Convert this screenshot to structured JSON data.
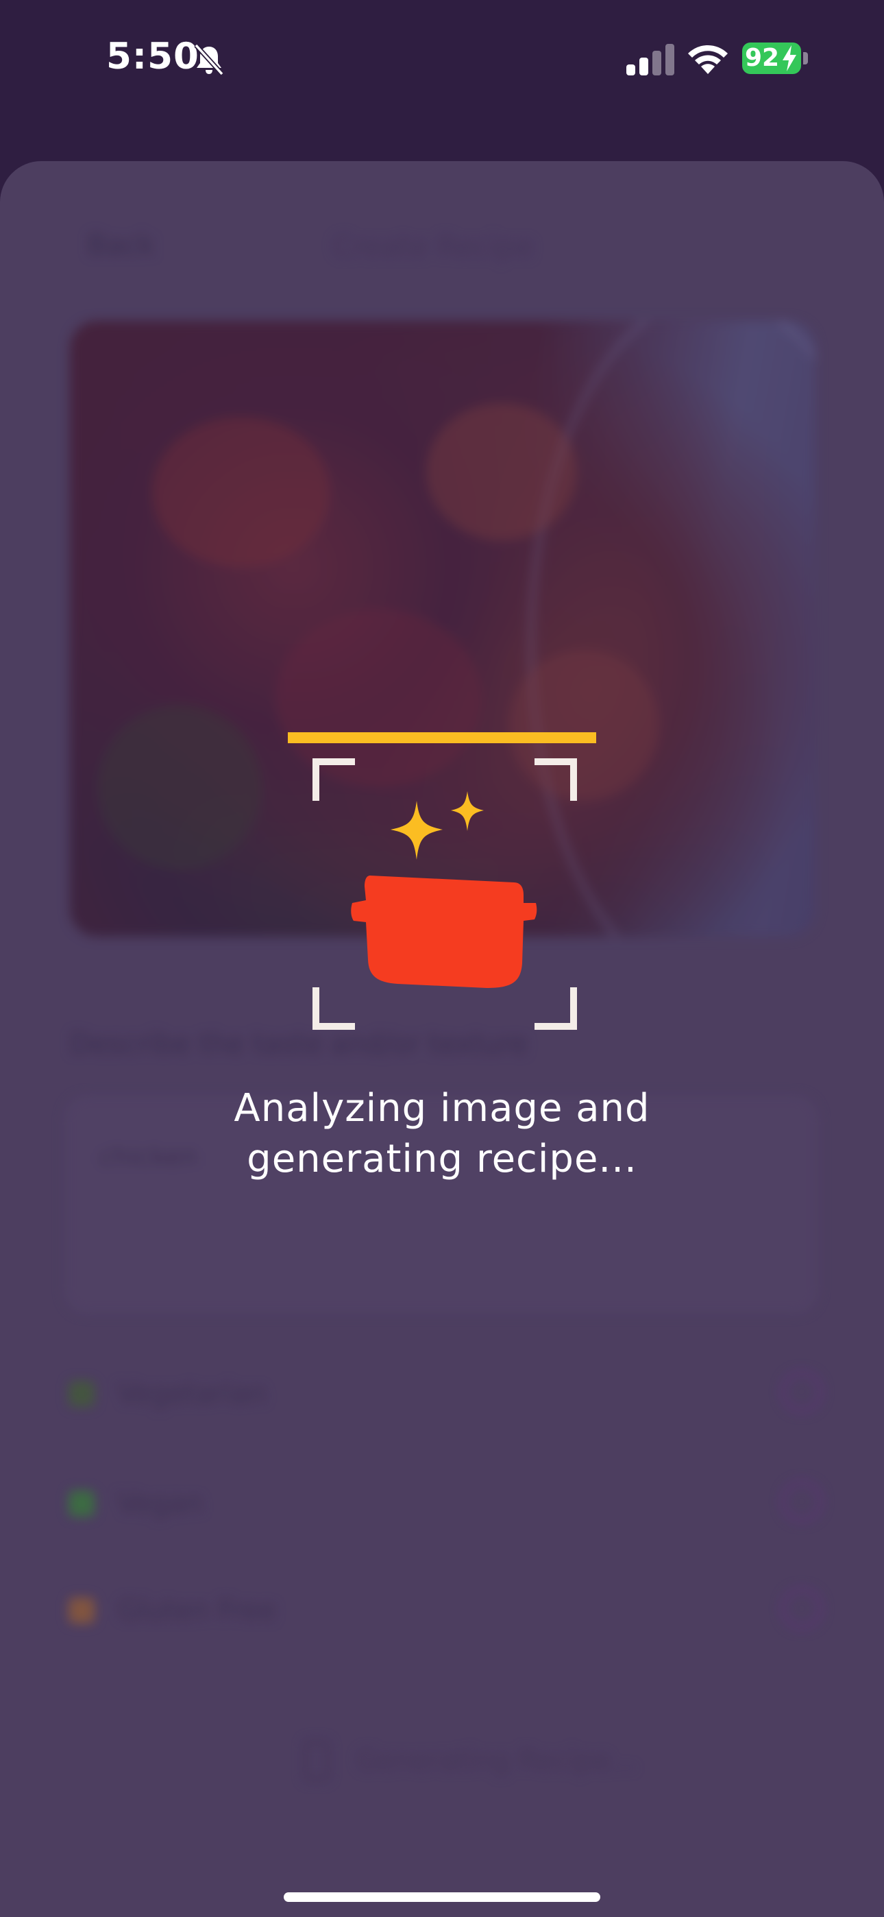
{
  "status_bar": {
    "time": "5:50",
    "battery": "92",
    "icons": [
      "bell-slash-icon",
      "cellular-signal-icon",
      "wifi-icon",
      "battery-charging-icon"
    ]
  },
  "background": {
    "nav_back": "Back",
    "nav_title": "Create Recipe",
    "describe_label": "Describe the taste and/or texture",
    "describe_value": "chicken",
    "toggles": [
      {
        "label": "Vegetarian",
        "emoji_color": "#4a6a3a"
      },
      {
        "label": "Vegan",
        "emoji_color": "#3f8a3e"
      },
      {
        "label": "Gluten Free",
        "emoji_color": "#a06a3a"
      }
    ],
    "generate_label": "Generating Recipe..."
  },
  "loading": {
    "line1": "Analyzing image and",
    "line2": "generating recipe...",
    "accent_color": "#fbbd22",
    "pot_color": "#f53c20"
  }
}
